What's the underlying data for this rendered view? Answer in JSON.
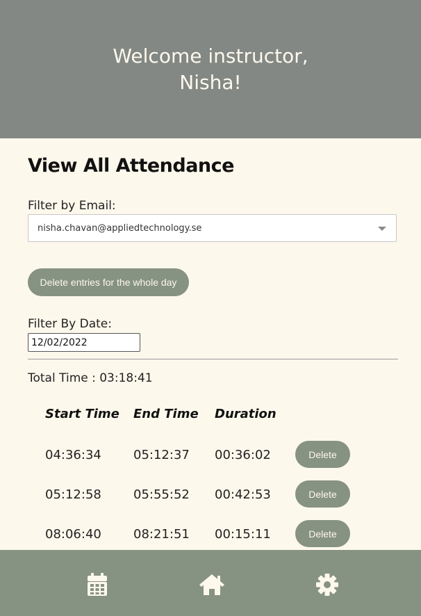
{
  "header": {
    "greeting_line1": "Welcome instructor,",
    "greeting_line2": "Nisha!"
  },
  "main": {
    "title": "View All Attendance",
    "filter_email_label": "Filter by Email:",
    "email_selected": "nisha.chavan@appliedtechnology.se",
    "delete_day_label": "Delete entries for the whole day",
    "filter_date_label": "Filter By Date:",
    "date_value": "12/02/2022",
    "total_time": "Total Time : 03:18:41"
  },
  "table": {
    "headers": [
      "Start Time",
      "End Time",
      "Duration"
    ],
    "delete_label": "Delete",
    "rows": [
      {
        "start": "04:36:34",
        "end": "05:12:37",
        "duration": "00:36:02"
      },
      {
        "start": "05:12:58",
        "end": "05:55:52",
        "duration": "00:42:53"
      },
      {
        "start": "08:06:40",
        "end": "08:21:51",
        "duration": "00:15:11"
      }
    ]
  },
  "nav": {
    "items": [
      "calendar-icon",
      "home-icon",
      "gear-icon"
    ]
  },
  "colors": {
    "header_bg": "#838885",
    "page_bg": "#fdf8ec",
    "accent": "#869282"
  }
}
